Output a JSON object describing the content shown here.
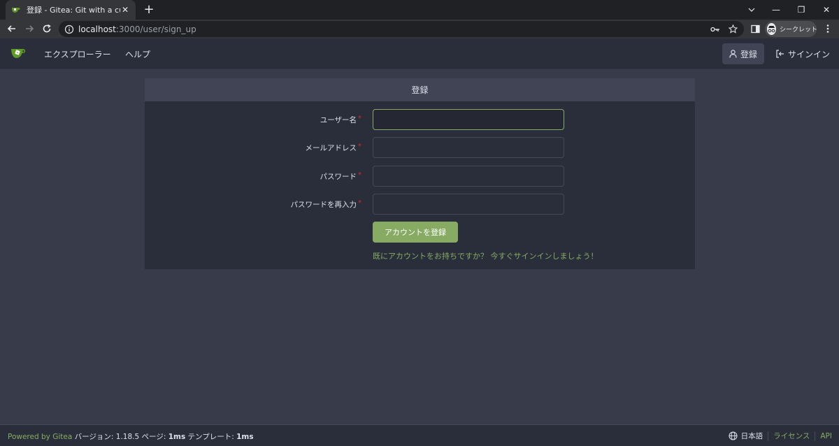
{
  "browser": {
    "tab_title": "登録 - Gitea: Git with a cup of tea",
    "tab_close": "✕",
    "new_tab": "+",
    "url_host": "localhost",
    "url_path": ":3000/user/sign_up",
    "profile_label": "シークレット",
    "window_minimize": "—",
    "window_restore": "❐",
    "window_close": "✕"
  },
  "header": {
    "nav_links": [
      "エクスプローラー",
      "ヘルプ"
    ],
    "register_label": "登録",
    "signin_label": "サインイン"
  },
  "form": {
    "title": "登録",
    "fields": [
      {
        "label": "ユーザー名",
        "value": ""
      },
      {
        "label": "メールアドレス",
        "value": ""
      },
      {
        "label": "パスワード",
        "value": ""
      },
      {
        "label": "パスワードを再入力",
        "value": ""
      }
    ],
    "required_mark": "*",
    "submit_label": "アカウントを登録",
    "signin_hint": "既にアカウントをお持ちですか？ 今すぐサインインしましょう！"
  },
  "footer": {
    "powered_by": "Powered by Gitea",
    "version_label": "バージョン:",
    "version": "1.18.5",
    "page_label": "ページ:",
    "page_time": "1ms",
    "template_label": "テンプレート:",
    "template_time": "1ms",
    "language": "日本語",
    "license": "ライセンス",
    "api": "API"
  },
  "colors": {
    "accent": "#87ab63",
    "background": "#383c4a",
    "surface": "#2a2e3a",
    "required": "#db2828"
  }
}
